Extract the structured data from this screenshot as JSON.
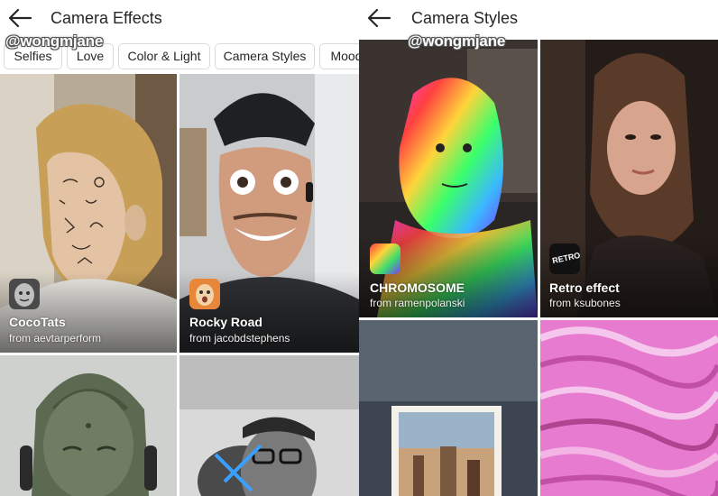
{
  "left": {
    "title": "Camera Effects",
    "watermark": "@wongmjane",
    "chips": [
      "Selfies",
      "Love",
      "Color & Light",
      "Camera Styles",
      "Mood"
    ],
    "tiles": [
      {
        "name": "CocoTats",
        "author": "from aevtarperform",
        "icon": "face-mask-icon"
      },
      {
        "name": "Rocky Road",
        "author": "from jacobdstephens",
        "icon": "surprised-face-icon"
      }
    ]
  },
  "right": {
    "title": "Camera Styles",
    "watermark": "@wongmjane",
    "tiles": [
      {
        "name": "CHROMOSOME",
        "author": "from ramenpolanski",
        "icon": "rainbow-icon"
      },
      {
        "name": "Retro effect",
        "author": "from ksubones",
        "icon": "retro-icon",
        "icon_text": "RETRO"
      }
    ]
  },
  "colors": {
    "text": "#262626",
    "chip_border": "#dbdbdb",
    "background": "#ffffff"
  }
}
